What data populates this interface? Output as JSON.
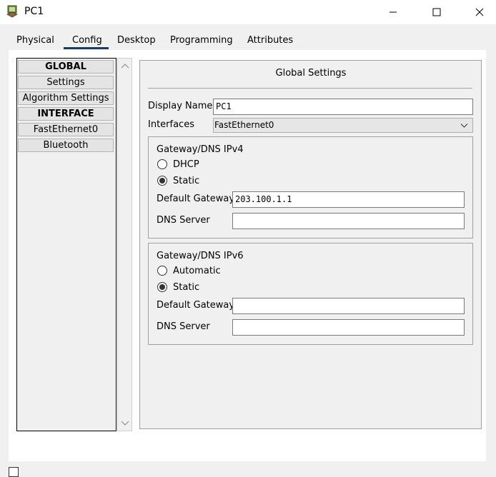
{
  "window": {
    "title": "PC1"
  },
  "tabs": [
    {
      "label": "Physical"
    },
    {
      "label": "Config"
    },
    {
      "label": "Desktop"
    },
    {
      "label": "Programming"
    },
    {
      "label": "Attributes"
    }
  ],
  "active_tab": "Config",
  "sidebar": {
    "items": [
      {
        "label": "GLOBAL",
        "header": true
      },
      {
        "label": "Settings"
      },
      {
        "label": "Algorithm Settings"
      },
      {
        "label": "INTERFACE",
        "header": true
      },
      {
        "label": "FastEthernet0"
      },
      {
        "label": "Bluetooth"
      }
    ]
  },
  "global": {
    "title": "Global Settings",
    "display_name_label": "Display Name",
    "display_name_value": "PC1",
    "interfaces_label": "Interfaces",
    "interfaces_value": "FastEthernet0"
  },
  "ipv4": {
    "title": "Gateway/DNS IPv4",
    "dhcp_label": "DHCP",
    "static_label": "Static",
    "selected": "Static",
    "gateway_label": "Default Gateway",
    "gateway_value": "203.100.1.1",
    "dns_label": "DNS Server",
    "dns_value": ""
  },
  "ipv6": {
    "title": "Gateway/DNS IPv6",
    "auto_label": "Automatic",
    "static_label": "Static",
    "selected": "Static",
    "gateway_label": "Default Gateway",
    "gateway_value": "",
    "dns_label": "DNS Server",
    "dns_value": ""
  },
  "colors": {
    "tab_underline": "#1a3b5d",
    "panel_bg": "#f0f0f0",
    "window_bg": "#ffffff"
  }
}
